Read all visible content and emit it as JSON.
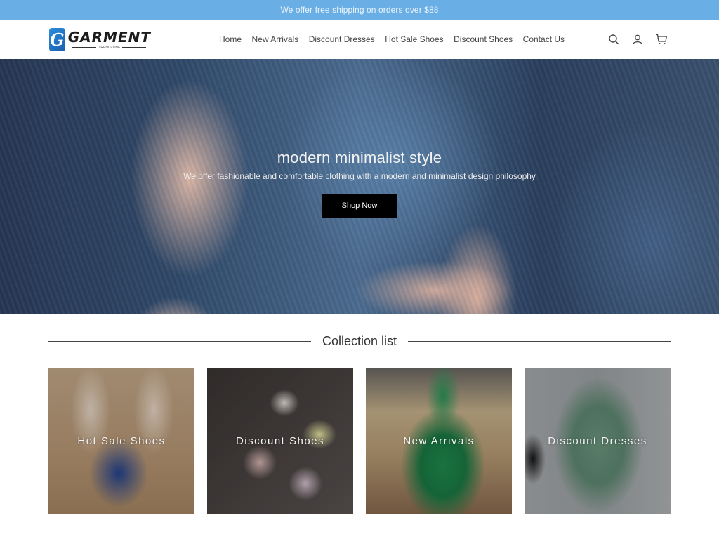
{
  "announcement": "We offer free shipping on orders over $88",
  "brand": {
    "name": "GARMENT",
    "tagline": "TRENDZONE",
    "badge_letter": "G"
  },
  "nav": {
    "items": [
      {
        "label": "Home"
      },
      {
        "label": "New Arrivals"
      },
      {
        "label": "Discount Dresses"
      },
      {
        "label": "Hot Sale Shoes"
      },
      {
        "label": "Discount Shoes"
      },
      {
        "label": "Contact Us"
      }
    ]
  },
  "header_icons": [
    "search-icon",
    "account-icon",
    "cart-icon"
  ],
  "hero": {
    "title": "modern minimalist style",
    "subtitle": "We offer fashionable and comfortable clothing with a modern and minimalist design philosophy",
    "button_label": "Shop Now"
  },
  "collection": {
    "heading": "Collection list",
    "cards": [
      {
        "label": "Hot Sale Shoes"
      },
      {
        "label": "Discount Shoes"
      },
      {
        "label": "New Arrivals"
      },
      {
        "label": "Discount Dresses"
      }
    ]
  },
  "colors": {
    "announcement_bg": "#6aaee6",
    "button_bg": "#000000",
    "brand_blue": "#2b8ddc"
  }
}
